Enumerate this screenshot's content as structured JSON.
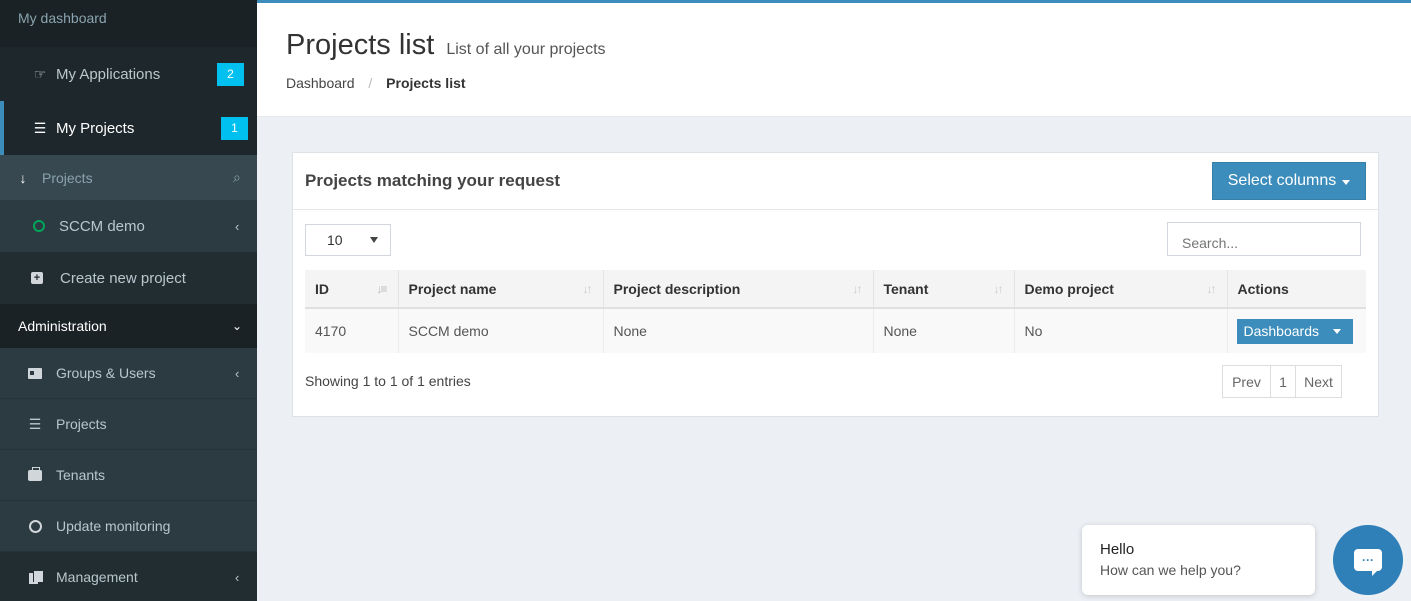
{
  "sidebar": {
    "header": "My dashboard",
    "items": [
      {
        "label": "My Applications",
        "icon": "hand-pointer-icon",
        "badge": "2"
      },
      {
        "label": "My Projects",
        "icon": "list-icon",
        "badge": "1"
      },
      {
        "label": "Projects",
        "icon": "sort-alpha-icon"
      },
      {
        "label": "SCCM demo",
        "icon": "circle-icon"
      },
      {
        "label": "Create new project",
        "icon": "plus-square-icon"
      }
    ],
    "admin_section": "Administration",
    "admin_items": [
      {
        "label": "Groups & Users",
        "icon": "id-card-icon"
      },
      {
        "label": "Projects",
        "icon": "list-icon"
      },
      {
        "label": "Tenants",
        "icon": "briefcase-icon"
      },
      {
        "label": "Update monitoring",
        "icon": "circle-notch-icon"
      },
      {
        "label": "Management",
        "icon": "copy-icon"
      }
    ]
  },
  "header": {
    "title": "Projects list",
    "subtitle": "List of all your projects",
    "breadcrumb": [
      "Dashboard",
      "Projects list"
    ]
  },
  "panel": {
    "title": "Projects matching your request",
    "select_columns_label": "Select columns",
    "page_length": "10",
    "search_placeholder": "Search...",
    "columns": [
      "ID",
      "Project name",
      "Project description",
      "Tenant",
      "Demo project",
      "Actions"
    ],
    "rows": [
      {
        "id": "4170",
        "name": "SCCM demo",
        "description": "None",
        "tenant": "None",
        "demo": "No",
        "action": "Dashboards"
      }
    ],
    "info": "Showing 1 to 1 of 1 entries",
    "pager": {
      "prev": "Prev",
      "page": "1",
      "next": "Next"
    }
  },
  "chat": {
    "hello": "Hello",
    "sub": "How can we help you?"
  },
  "colors": {
    "sidebar_bg": "#222d32",
    "accent": "#3c8dbc",
    "badge": "#00c0ef",
    "status_green": "#00a65a"
  }
}
